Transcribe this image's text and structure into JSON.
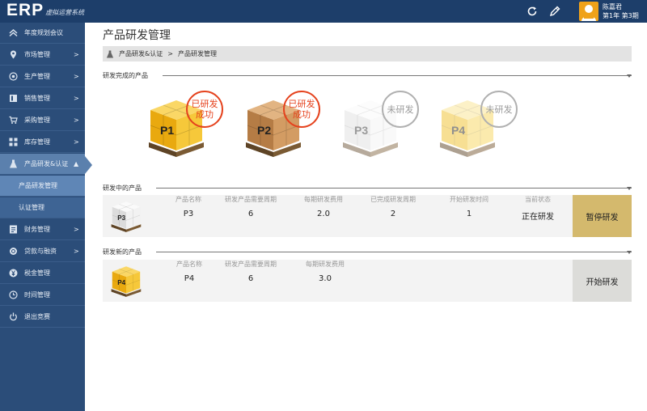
{
  "app": {
    "logo": "ERP",
    "logo_sub": "虚拟运营系统"
  },
  "user": {
    "name": "陈嘉君",
    "period": "第1年 第3期"
  },
  "topbar_icons": [
    "refresh-icon",
    "edit-icon"
  ],
  "sidebar": {
    "items": [
      {
        "label": "年度规划会议",
        "icon": "chevrons-up-icon",
        "arrow": ""
      },
      {
        "label": "市场管理",
        "icon": "map-pin-icon",
        "arrow": ">"
      },
      {
        "label": "生产管理",
        "icon": "target-icon",
        "arrow": ">"
      },
      {
        "label": "销售管理",
        "icon": "book-icon",
        "arrow": ">"
      },
      {
        "label": "采购管理",
        "icon": "cart-icon",
        "arrow": ">"
      },
      {
        "label": "库存管理",
        "icon": "grid-icon",
        "arrow": ">"
      },
      {
        "label": "产品研发&认证",
        "icon": "flask-icon",
        "arrow": "▲"
      },
      {
        "label": "产品研发管理",
        "icon": "",
        "arrow": ""
      },
      {
        "label": "认证管理",
        "icon": "",
        "arrow": ""
      },
      {
        "label": "财务管理",
        "icon": "ledger-icon",
        "arrow": ">"
      },
      {
        "label": "贷款与融资",
        "icon": "coins-icon",
        "arrow": ">"
      },
      {
        "label": "税金管理",
        "icon": "yen-icon",
        "arrow": ""
      },
      {
        "label": "时间管理",
        "icon": "clock-icon",
        "arrow": ""
      },
      {
        "label": "退出竞赛",
        "icon": "power-icon",
        "arrow": ""
      }
    ]
  },
  "page": {
    "title": "产品研发管理"
  },
  "breadcrumb": {
    "parent": "产品研发&认证",
    "separator": ">",
    "current": "产品研发管理"
  },
  "completed": {
    "title": "研发完成的产品",
    "products": [
      {
        "label": "P1",
        "status": "已研发成功",
        "color": "#f2b318",
        "dim": false
      },
      {
        "label": "P2",
        "status": "已研发成功",
        "color": "#c98f55",
        "dim": false
      },
      {
        "label": "P3",
        "status": "未研发",
        "color": "#eeeeee",
        "dim": true
      },
      {
        "label": "P4",
        "status": "未研发",
        "color": "#f6dc7a",
        "dim": true
      }
    ]
  },
  "in_progress": {
    "title": "研发中的产品",
    "thumb_label": "P3",
    "headers": {
      "name": "产品名称",
      "cycle": "研发产品需要周期",
      "cost": "每期研发费用",
      "done": "已完成研发周期",
      "start": "开始研发时间",
      "state": "当前状态"
    },
    "values": {
      "name": "P3",
      "cycle": "6",
      "cost": "2.0",
      "done": "2",
      "start": "1",
      "state": "正在研发"
    },
    "button": "暂停研发"
  },
  "new_dev": {
    "title": "研发新的产品",
    "thumb_label": "P4",
    "headers": {
      "name": "产品名称",
      "cycle": "研发产品需要周期",
      "cost": "每期研发费用"
    },
    "values": {
      "name": "P4",
      "cycle": "6",
      "cost": "3.0"
    },
    "button": "开始研发"
  }
}
